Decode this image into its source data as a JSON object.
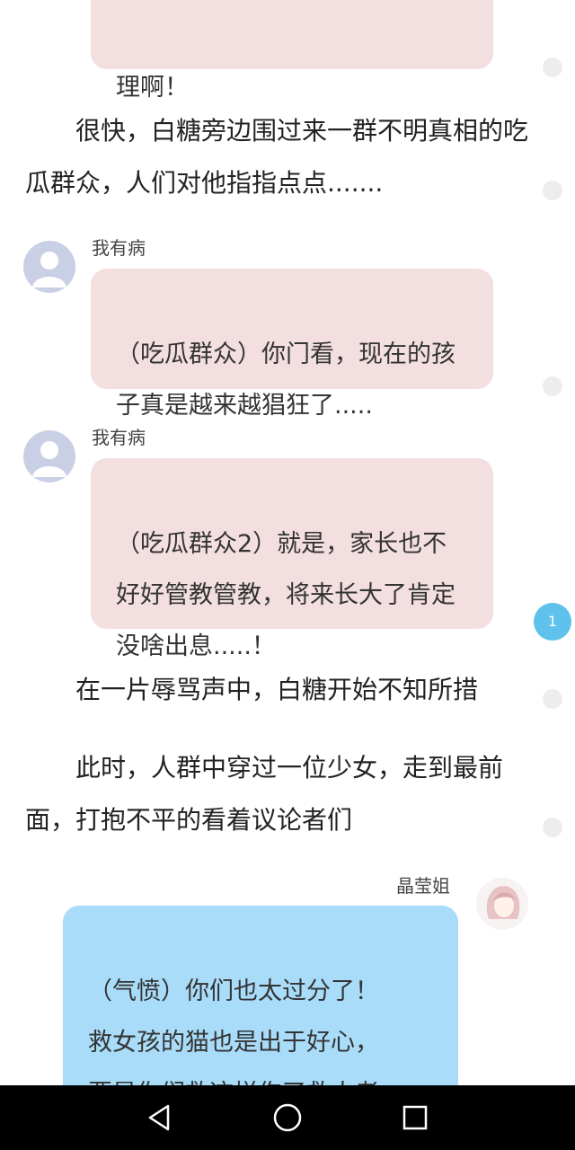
{
  "messages": {
    "top_bubble": "理啊！",
    "narration_1": "　　很快，白糖旁边围过来一群不明真相的吃瓜群众，人们对他指指点点.......",
    "msg1_name": "我有病",
    "msg1_text": "（吃瓜群众）你门看，现在的孩子真是越来越猖狂了.....",
    "msg2_name": "我有病",
    "msg2_text": "（吃瓜群众2）就是，家长也不好好管教管教，将来长大了肯定没啥出息.....！",
    "narration_2": "　　在一片辱骂声中，白糖开始不知所措",
    "narration_3": "　　此时，人群中穿过一位少女，走到最前面，打抱不平的看着议论者们",
    "msg3_name": "晶莹姐",
    "msg3_text": "（气愤）你们也太过分了！\n救女孩的猫也是出于好心，\n要是你们救这样伤了救人者\n的心，以后谁还敢救？"
  },
  "comment_badge": "1",
  "nav": {
    "back_icon": "triangle-back-icon",
    "home_icon": "circle-home-icon",
    "recent_icon": "square-recent-icon"
  }
}
